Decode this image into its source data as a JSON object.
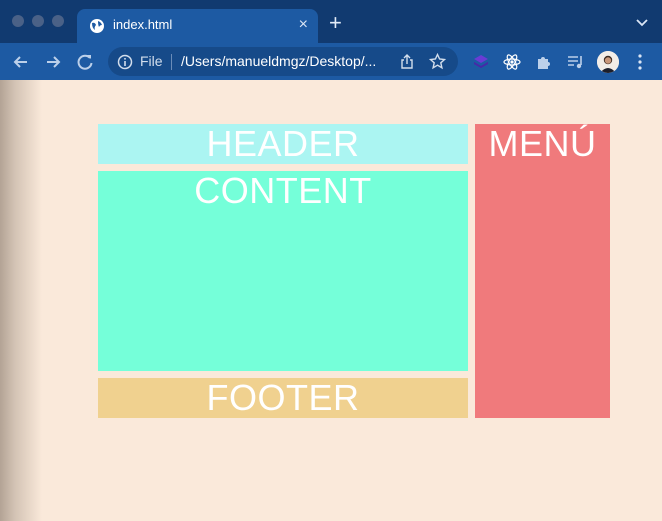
{
  "browser": {
    "tab": {
      "title": "index.html",
      "close": "×"
    },
    "new_tab": "+",
    "omnibox": {
      "scheme_label": "File",
      "url": "/Users/manueldmgz/Desktop/..."
    }
  },
  "page": {
    "header": "HEADER",
    "content": "CONTENT",
    "footer": "FOOTER",
    "menu": "MENÚ"
  },
  "colors": {
    "header": "#abf5f2",
    "content": "#75ffd9",
    "footer": "#f0d18f",
    "menu": "#f07a7c",
    "background": "#fae9da"
  }
}
